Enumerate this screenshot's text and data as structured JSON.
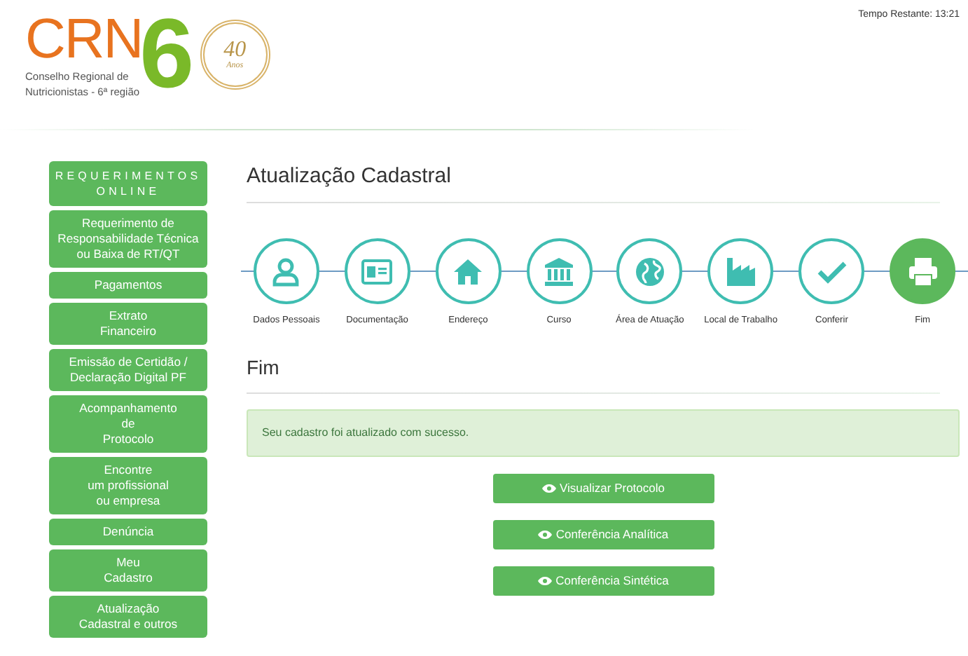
{
  "header": {
    "logo": {
      "letters": "CRN",
      "digit": "6",
      "subtitle_lines": [
        "Conselho Regional de",
        "Nutricionistas - 6ª região"
      ],
      "seal_number": "40",
      "seal_word": "Anos"
    },
    "timer": "Tempo Restante: 13:21"
  },
  "sidebar": {
    "title_lines": [
      "REQUERIMENTOS",
      "ONLINE"
    ],
    "items": [
      {
        "lines": [
          "Requerimento de",
          "Responsabilidade Técnica",
          "ou Baixa de RT/QT"
        ]
      },
      {
        "lines": [
          "Pagamentos"
        ]
      },
      {
        "lines": [
          "Extrato",
          "Financeiro"
        ]
      },
      {
        "lines": [
          "Emissão de Certidão /",
          "Declaração Digital PF"
        ]
      },
      {
        "lines": [
          "Acompanhamento",
          "de",
          "Protocolo"
        ]
      },
      {
        "lines": [
          "Encontre",
          "um profissional",
          "ou empresa"
        ]
      },
      {
        "lines": [
          "Denúncia"
        ]
      },
      {
        "lines": [
          "Meu",
          "Cadastro"
        ]
      },
      {
        "lines": [
          "Atualização",
          "Cadastral e outros"
        ]
      }
    ]
  },
  "page_title": "Atualização Cadastral",
  "steps": [
    {
      "label": "Dados Pessoais",
      "kind": "person",
      "selected": false
    },
    {
      "label": "Documentação",
      "kind": "idcard",
      "selected": false
    },
    {
      "label": "Endereço",
      "kind": "house",
      "selected": false
    },
    {
      "label": "Curso",
      "kind": "building",
      "selected": false
    },
    {
      "label": "Área de Atuação",
      "kind": "globe",
      "selected": false
    },
    {
      "label": "Local de Trabalho",
      "kind": "factory",
      "selected": false
    },
    {
      "label": "Conferir",
      "kind": "check",
      "selected": false
    },
    {
      "label": "Fim",
      "kind": "printer",
      "selected": true
    }
  ],
  "section_title": "Fim",
  "alert": "Seu cadastro foi atualizado com sucesso.",
  "buttons": [
    "Visualizar Protocolo",
    "Conferência Analítica",
    "Conferência Sintética"
  ]
}
